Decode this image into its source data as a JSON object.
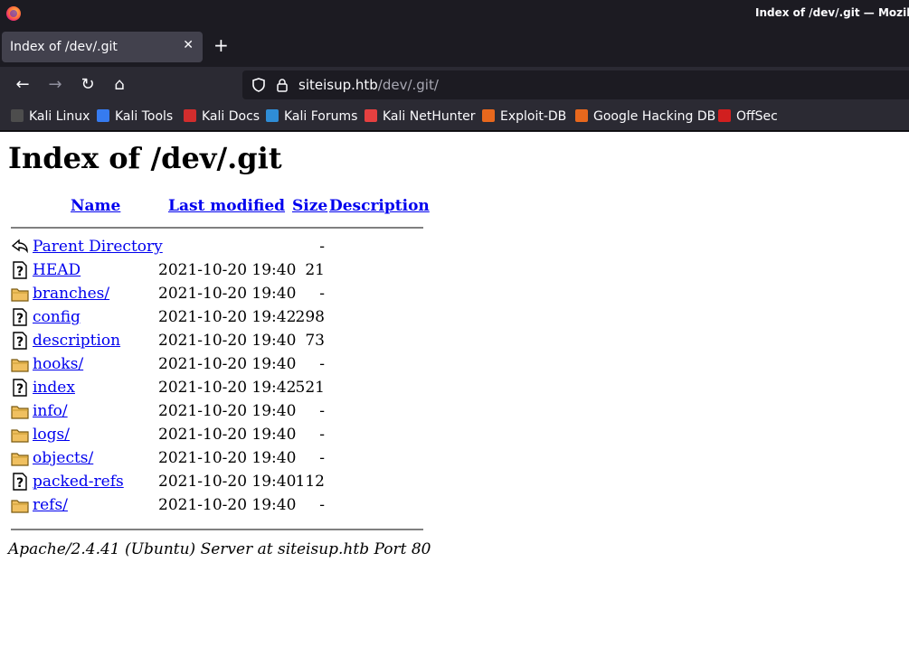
{
  "window": {
    "title": "Index of /dev/.git — Mozilla Fi"
  },
  "tab": {
    "title": "Index of /dev/.git",
    "close_glyph": "✕",
    "new_tab_glyph": "+"
  },
  "nav": {
    "back_glyph": "←",
    "forward_glyph": "→",
    "reload_glyph": "↻",
    "home_glyph": "⌂",
    "url_host": "siteisup.htb",
    "url_path": "/dev/.git/"
  },
  "bookmarks": [
    {
      "label": "Kali Linux",
      "color": "#4d4d4d"
    },
    {
      "label": "Kali Tools",
      "color": "#367bf0"
    },
    {
      "label": "Kali Docs",
      "color": "#d22d2d"
    },
    {
      "label": "Kali Forums",
      "color": "#2f8dd6"
    },
    {
      "label": "Kali NetHunter",
      "color": "#e64040"
    },
    {
      "label": "Exploit-DB",
      "color": "#e8681d"
    },
    {
      "label": "Google Hacking DB",
      "color": "#e8681d"
    },
    {
      "label": "OffSec",
      "color": "#d11f1f"
    }
  ],
  "page": {
    "title": "Index of /dev/.git",
    "headers": {
      "name": "Name",
      "modified": "Last modified",
      "size": "Size",
      "description": "Description"
    },
    "rows": [
      {
        "name": "Parent Directory",
        "modified": "",
        "size": "-",
        "icon": "back-icon"
      },
      {
        "name": "HEAD",
        "modified": "2021-10-20 19:40",
        "size": "21",
        "icon": "unknown-file-icon"
      },
      {
        "name": "branches/",
        "modified": "2021-10-20 19:40",
        "size": "-",
        "icon": "folder-icon"
      },
      {
        "name": "config",
        "modified": "2021-10-20 19:42",
        "size": "298",
        "icon": "unknown-file-icon"
      },
      {
        "name": "description",
        "modified": "2021-10-20 19:40",
        "size": "73",
        "icon": "unknown-file-icon"
      },
      {
        "name": "hooks/",
        "modified": "2021-10-20 19:40",
        "size": "-",
        "icon": "folder-icon"
      },
      {
        "name": "index",
        "modified": "2021-10-20 19:42",
        "size": "521",
        "icon": "unknown-file-icon"
      },
      {
        "name": "info/",
        "modified": "2021-10-20 19:40",
        "size": "-",
        "icon": "folder-icon"
      },
      {
        "name": "logs/",
        "modified": "2021-10-20 19:40",
        "size": "-",
        "icon": "folder-icon"
      },
      {
        "name": "objects/",
        "modified": "2021-10-20 19:40",
        "size": "-",
        "icon": "folder-icon"
      },
      {
        "name": "packed-refs",
        "modified": "2021-10-20 19:40",
        "size": "112",
        "icon": "unknown-file-icon"
      },
      {
        "name": "refs/",
        "modified": "2021-10-20 19:40",
        "size": "-",
        "icon": "folder-icon"
      }
    ],
    "footer": "Apache/2.4.41 (Ubuntu) Server at siteisup.htb Port 80"
  }
}
